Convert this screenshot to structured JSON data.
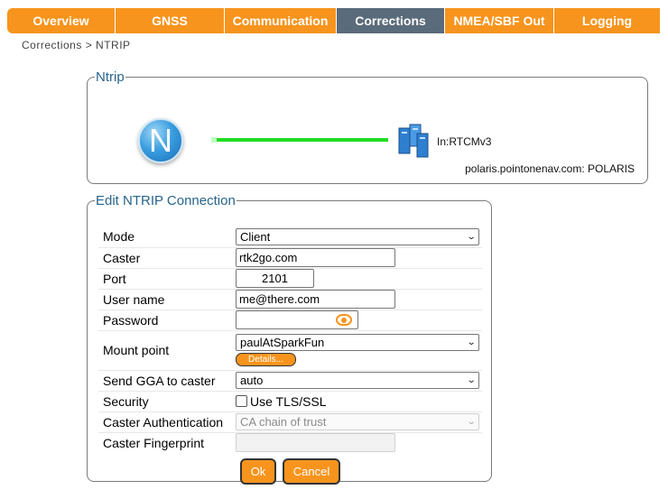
{
  "nav": {
    "tabs": [
      {
        "label": "Overview",
        "active": false
      },
      {
        "label": "GNSS",
        "active": false
      },
      {
        "label": "Communication",
        "active": false
      },
      {
        "label": "Corrections",
        "active": true
      },
      {
        "label": "NMEA/SBF Out",
        "active": false
      },
      {
        "label": "Logging",
        "active": false
      }
    ]
  },
  "breadcrumb": "Corrections > NTRIP",
  "ntrip_panel": {
    "legend": "Ntrip",
    "logo_letter": "N",
    "stream_label": "In:RTCMv3",
    "caster_info": "polaris.pointonenav.com: POLARIS",
    "link_status_color": "#22dd22"
  },
  "edit_panel": {
    "legend": "Edit NTRIP Connection",
    "mode": {
      "label": "Mode",
      "value": "Client"
    },
    "caster": {
      "label": "Caster",
      "value": "rtk2go.com"
    },
    "port": {
      "label": "Port",
      "value": "2101"
    },
    "user_name": {
      "label": "User name",
      "value": "me@there.com"
    },
    "password": {
      "label": "Password",
      "value": "",
      "toggle_icon": "eye-icon"
    },
    "mount_point": {
      "label": "Mount point",
      "value": "paulAtSparkFun",
      "details_label": "Details..."
    },
    "send_gga": {
      "label": "Send GGA to caster",
      "value": "auto"
    },
    "security": {
      "label": "Security",
      "checkbox_label": "Use TLS/SSL",
      "checked": false
    },
    "caster_auth": {
      "label": "Caster Authentication",
      "value": "CA chain of trust",
      "disabled": true
    },
    "caster_fingerprint": {
      "label": "Caster Fingerprint",
      "value": "",
      "disabled": true
    },
    "ok_label": "Ok",
    "cancel_label": "Cancel"
  },
  "colors": {
    "accent": "#f7941d",
    "active_tab": "#5a6b7b",
    "legend_text": "#27648c"
  }
}
